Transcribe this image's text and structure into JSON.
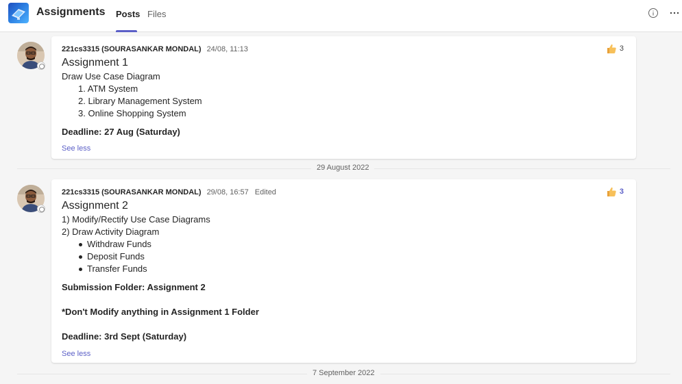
{
  "header": {
    "title": "Assignments",
    "tabs": [
      {
        "label": "Posts"
      },
      {
        "label": "Files"
      }
    ],
    "icons": [
      "app-icon",
      "info-icon",
      "more-icon"
    ],
    "accent": "#5b5fc7"
  },
  "posts": [
    {
      "author": "221cs3315 (SOURASANKAR MONDAL)",
      "time": "24/08, 11:13",
      "reaction_count": "3",
      "title": "Assignment 1",
      "body": {
        "intro": "Draw Use Case Diagram",
        "items": [
          "1. ATM System",
          "2. Library Management System",
          "3. Online Shopping System"
        ],
        "deadline": "Deadline: 27 Aug (Saturday)"
      },
      "see_less": "See less"
    },
    {
      "author": "221cs3315 (SOURASANKAR MONDAL)",
      "time": "29/08, 16:57",
      "edited": "Edited",
      "reaction_count": "3",
      "title": "Assignment 2",
      "body": {
        "lines": [
          "1) Modify/Rectify Use Case Diagrams",
          "2) Draw Activity Diagram"
        ],
        "bullets": [
          "Withdraw Funds",
          "Deposit Funds",
          "Transfer Funds"
        ],
        "submission": "Submission Folder: Assignment 2",
        "note": "*Don't Modify anything in Assignment 1 Folder",
        "deadline": "Deadline: 3rd Sept (Saturday)"
      },
      "see_less": "See less"
    }
  ],
  "date_separators": [
    "29 August 2022",
    "7 September 2022"
  ]
}
